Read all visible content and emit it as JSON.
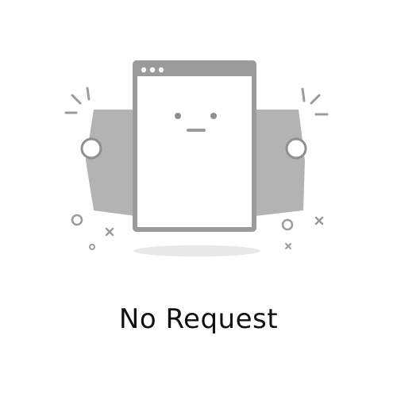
{
  "empty_state": {
    "title": "No Request",
    "illustration_icon": "blank-browser-window-with-neutral-face",
    "colors": {
      "illustration_fill": "#b3b3b3",
      "illustration_stroke": "#8f8f8f",
      "window_face": "#ffffff",
      "shadow": "#e8e8e8",
      "text": "#111111"
    }
  }
}
